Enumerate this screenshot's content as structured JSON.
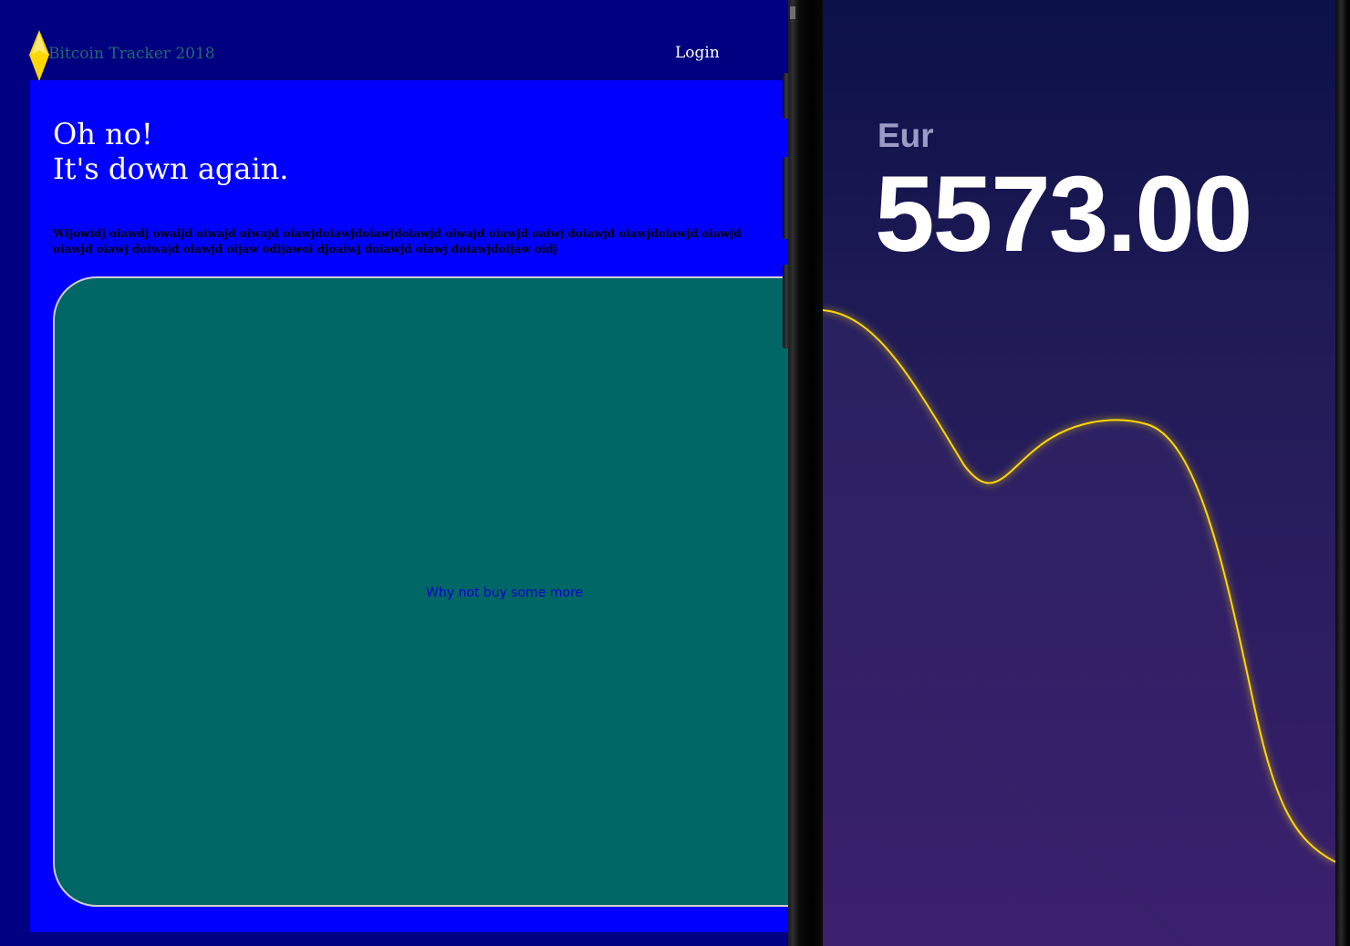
{
  "web": {
    "brand": "Bitcoin Tracker 2018",
    "login_label": "Login",
    "headline_line1": "Oh no!",
    "headline_line2": "It's down again.",
    "body_line1": "Wijowidj oiawdj owaijd oiwajd oiwajd oiawjdoiawjdoiawjdoiawjd oiwajd oiawjd oaiwj doiawjd oiawjdoiawjd oiawjd",
    "body_line2": "oiawjd oiawj doiwajd oiawjd oijaw odijawoi djoaiwj doiawjd oiawj doiawjdoijaw oidj",
    "buy_link": "Why not buy some more",
    "colors": {
      "page_bg": "#000080",
      "hero_bg": "#0000ff",
      "card_bg": "#006666",
      "brand_text": "#1f6b6b",
      "logo": "#ffd700"
    },
    "logo_icon": "diamond-logo-icon"
  },
  "phone": {
    "currency": "Eur",
    "price": "5573.00",
    "chart_line_color": "#ffd700"
  }
}
